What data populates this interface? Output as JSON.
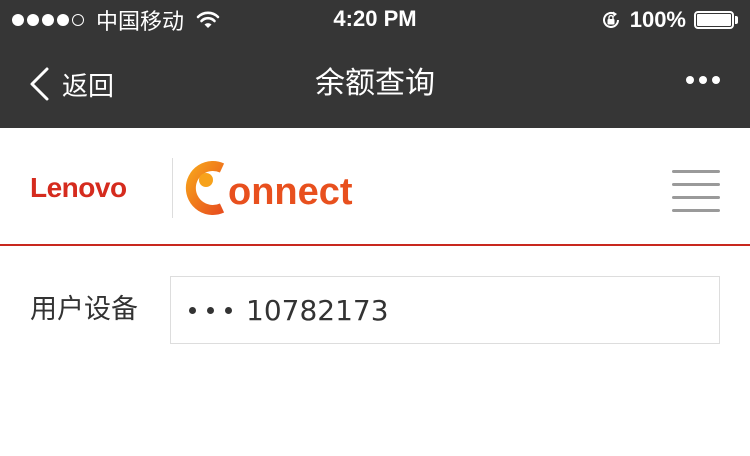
{
  "status_bar": {
    "carrier": "中国移动",
    "time": "4:20 PM",
    "battery": "100%",
    "signal_bars_filled": 4,
    "signal_bars_total": 5
  },
  "nav": {
    "back_label": "返回",
    "title": "余额查询",
    "more_icon": "more-dots-icon"
  },
  "brand": {
    "lenovo": "Lenovo",
    "connect_initial": "C",
    "connect_rest": "onnect",
    "lenovo_color": "#d52b1e",
    "connect_color": "#e8501e",
    "menu_icon": "hamburger-menu-icon"
  },
  "form": {
    "label": "用户设备",
    "value": "10782173",
    "masked_prefix": "•••"
  },
  "colors": {
    "bar_background": "#363636",
    "accent_line": "#c8281e"
  }
}
